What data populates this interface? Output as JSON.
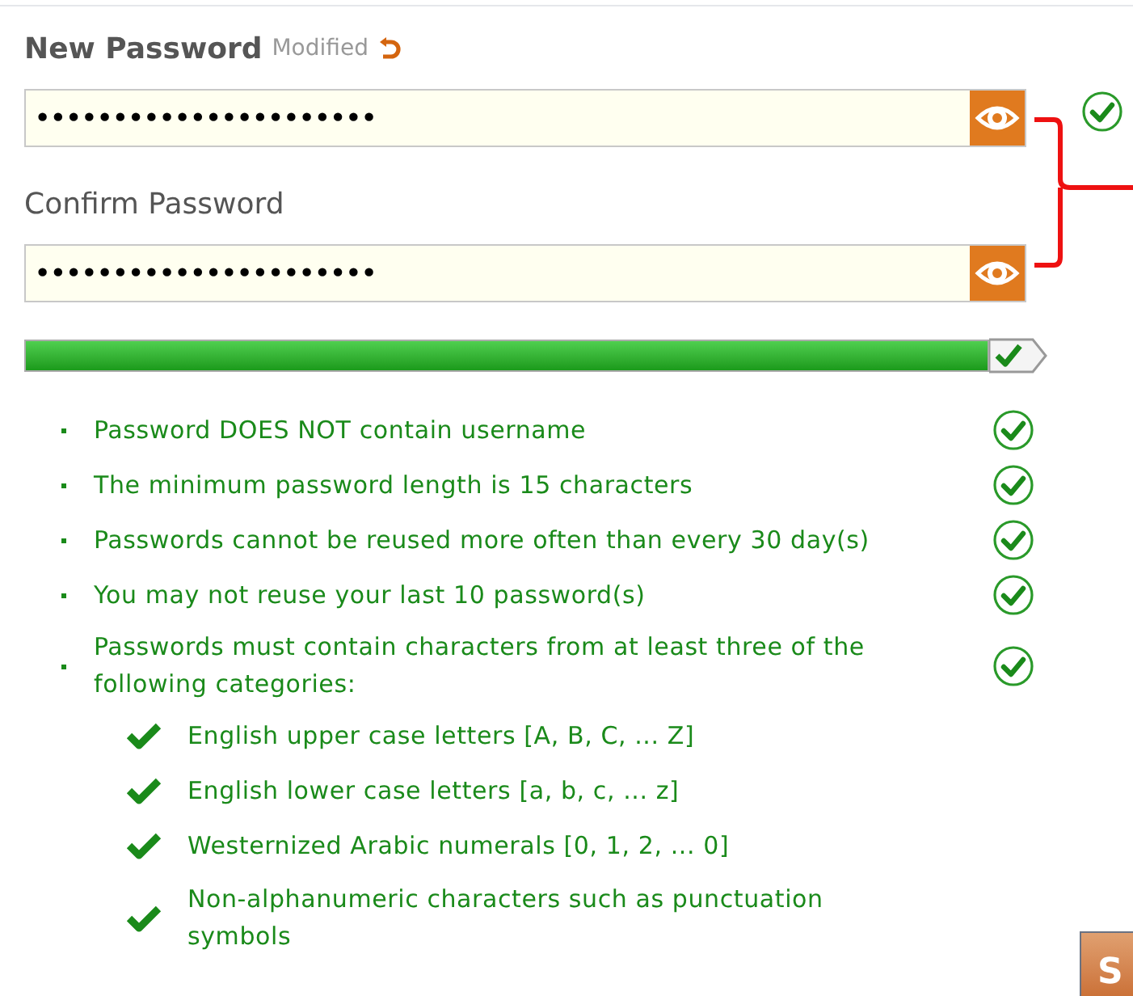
{
  "fields": [
    {
      "label": "New Password",
      "modified_note": "Modified",
      "value": "••••••••••••••••••••••",
      "valid": true
    },
    {
      "label": "Confirm Password",
      "value": "••••••••••••••••••••••"
    }
  ],
  "strength": {
    "level": 1.0,
    "passed": true
  },
  "rules": [
    {
      "text": "Password DOES NOT contain username",
      "met": true
    },
    {
      "text": "The minimum password length is 15 characters",
      "met": true
    },
    {
      "text": "Passwords cannot be reused more often than every 30 day(s)",
      "met": true
    },
    {
      "text": "You may not reuse your last 10 password(s)",
      "met": true
    },
    {
      "text": "Passwords must contain characters from at least three of the following categories:",
      "met": true,
      "children": [
        {
          "text": "English upper case letters [A, B, C, ... Z]",
          "met": true
        },
        {
          "text": "English lower case letters [a, b, c, ... z]",
          "met": true
        },
        {
          "text": "Westernized Arabic numerals [0, 1, 2, ... 0]",
          "met": true
        },
        {
          "text": "Non-alphanumeric characters such as punctuation symbols",
          "met": true
        }
      ]
    }
  ],
  "submit_button": {
    "label": "S"
  }
}
